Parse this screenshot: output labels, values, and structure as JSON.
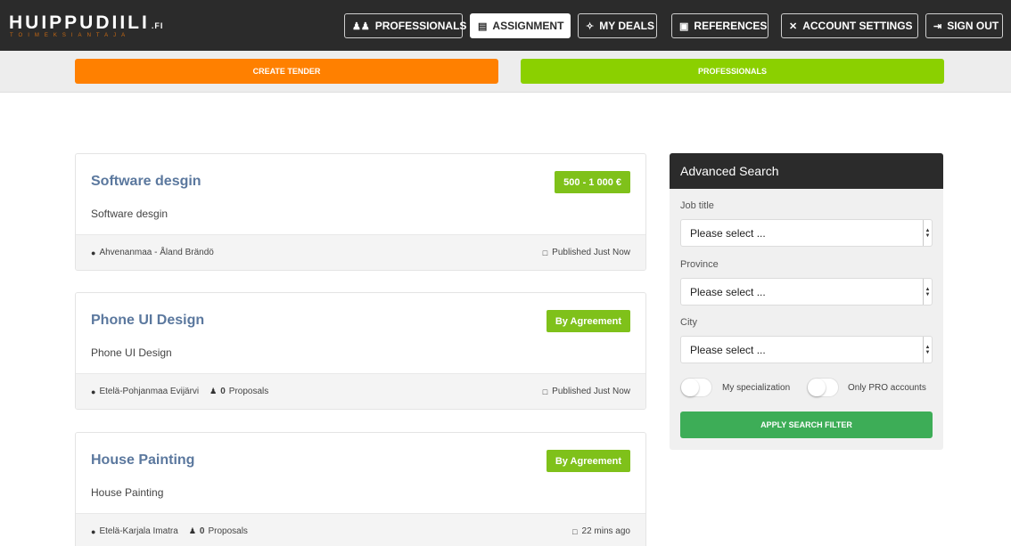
{
  "header": {
    "logo": "HUIPPUDIILI",
    "logo_tld": ".FI",
    "logo_sub": "TOIMEKSIANTAJA",
    "nav": [
      {
        "label": "PROFESSIONALS",
        "icon": "users-icon"
      },
      {
        "label": "ASSIGNMENT",
        "icon": "document-icon"
      },
      {
        "label": "MY DEALS",
        "icon": "handshake-icon"
      },
      {
        "label": "REFERENCES",
        "icon": "briefcase-icon"
      },
      {
        "label": "ACCOUNT SETTINGS",
        "icon": "tools-icon"
      },
      {
        "label": "SIGN OUT",
        "icon": "sign-out-icon"
      }
    ]
  },
  "subbar": {
    "create_tender": "CREATE TENDER",
    "professionals": "PROFESSIONALS"
  },
  "listings": [
    {
      "title": "Software desgin",
      "description": "Software desgin",
      "badge": "500 - 1 000 €",
      "location": "Ahvenanmaa - Åland Brändö",
      "proposals_count": "",
      "proposals_label": "",
      "published": "Published Just Now"
    },
    {
      "title": "Phone UI Design",
      "description": "Phone UI Design",
      "badge": "By Agreement",
      "location": "Etelä-Pohjanmaa Evijärvi",
      "proposals_count": "0",
      "proposals_label": "Proposals",
      "published": "Published Just Now"
    },
    {
      "title": "House Painting",
      "description": "House Painting",
      "badge": "By Agreement",
      "location": "Etelä-Karjala Imatra",
      "proposals_count": "0",
      "proposals_label": "Proposals",
      "published": "22 mins ago"
    }
  ],
  "search": {
    "title": "Advanced Search",
    "job_title_label": "Job title",
    "job_title_value": "Please select ...",
    "province_label": "Province",
    "province_value": "Please select ...",
    "city_label": "City",
    "city_value": "Please select ...",
    "toggle_specialization": "My specialization",
    "toggle_pro": "Only PRO accounts",
    "apply": "APPLY SEARCH FILTER"
  },
  "colors": {
    "topbar": "#2b2b2b",
    "orange": "#ff8000",
    "green": "#8bd000",
    "badge": "#7fc11a",
    "apply": "#3dad57",
    "title": "#5b789e"
  }
}
